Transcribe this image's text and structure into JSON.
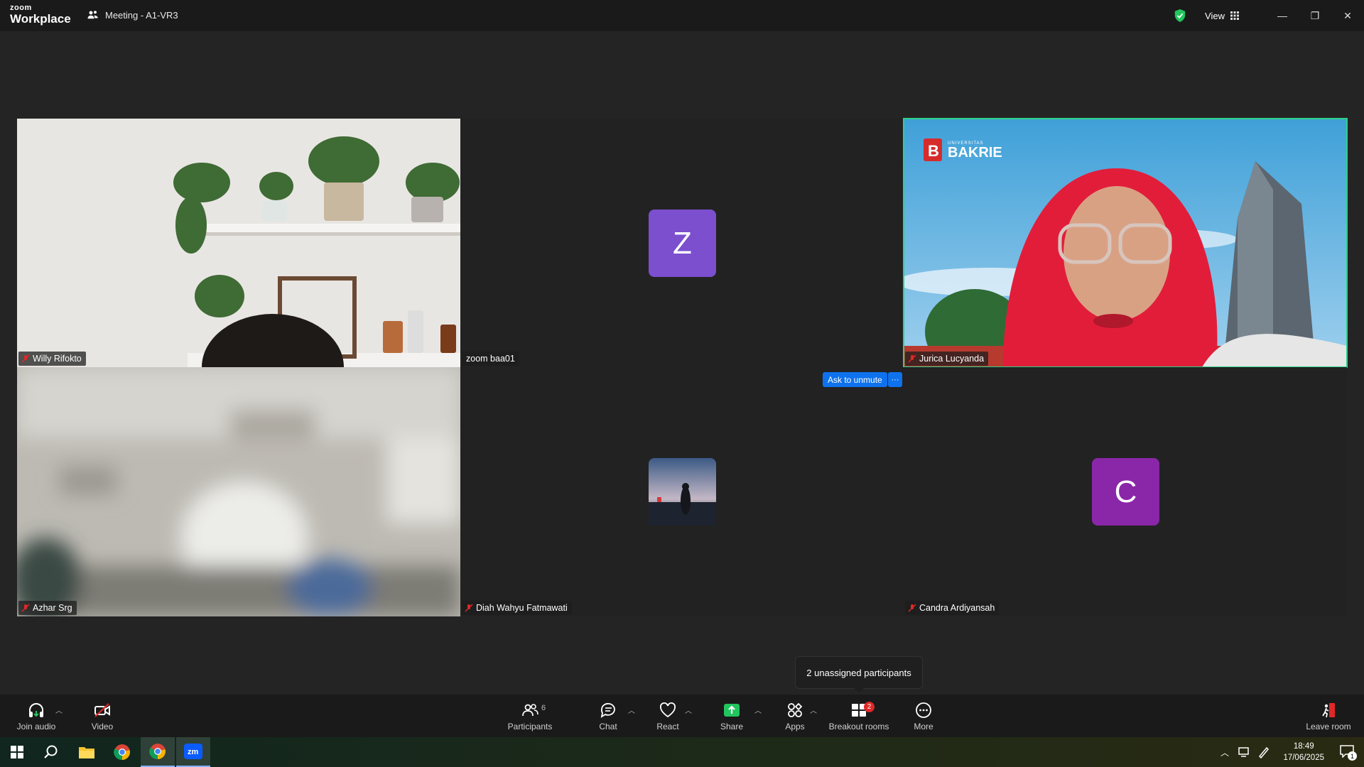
{
  "app": {
    "brand_top": "zoom",
    "brand_bottom": "Workplace",
    "meeting_title": "Meeting - A1-VR3"
  },
  "header": {
    "view_label": "View"
  },
  "participants": [
    {
      "name": "Willy Rifokto",
      "muted": true,
      "type": "video"
    },
    {
      "name": "zoom baa01",
      "muted": false,
      "type": "avatar",
      "initial": "Z",
      "color": "#7b4fce"
    },
    {
      "name": "Jurica Lucyanda",
      "muted": true,
      "type": "video",
      "active": true,
      "logo_text": "BAKRIE",
      "logo_small": "UNIVERSITAS"
    },
    {
      "name": "Azhar Srg",
      "muted": true,
      "type": "video"
    },
    {
      "name": "Diah Wahyu Fatmawati",
      "muted": true,
      "type": "photo"
    },
    {
      "name": "Candra Ardiyansah",
      "muted": true,
      "type": "avatar",
      "initial": "C",
      "color": "#8a26a8"
    }
  ],
  "ask_unmute": {
    "label": "Ask to unmute",
    "more": "···"
  },
  "tooltip": {
    "text": "2 unassigned participants"
  },
  "toolbar": {
    "join_audio": "Join audio",
    "video": "Video",
    "participants": "Participants",
    "participants_count": "6",
    "chat": "Chat",
    "react": "React",
    "share": "Share",
    "apps": "Apps",
    "breakout_rooms": "Breakout rooms",
    "breakout_badge": "2",
    "more": "More",
    "leave_room": "Leave room"
  },
  "taskbar": {
    "time": "18:49",
    "date": "17/06/2025",
    "notifications": "1"
  },
  "colors": {
    "accent": "#0e72ed",
    "active_speaker": "#2bd18a",
    "muted": "#e02828",
    "share": "#22c55e"
  }
}
